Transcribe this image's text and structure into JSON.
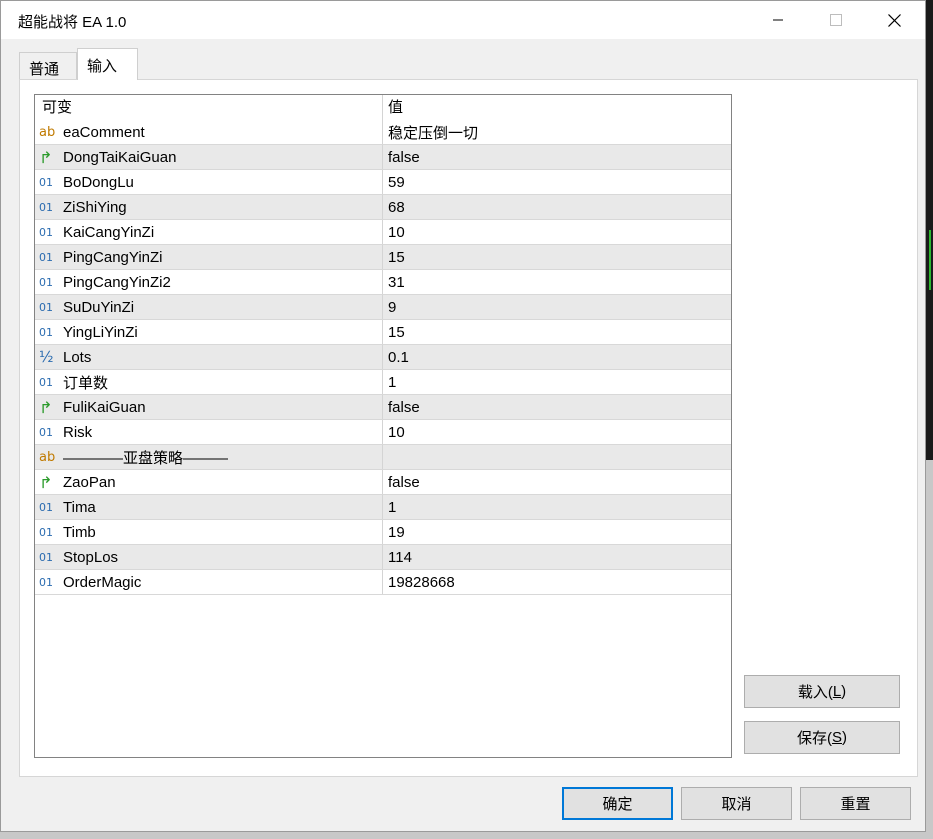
{
  "window": {
    "title": "超能战将 EA 1.0",
    "minimize_icon": "minimize-icon",
    "maximize_icon": "maximize-icon",
    "close_icon": "close-icon"
  },
  "tabs": [
    {
      "label": "普通",
      "active": false
    },
    {
      "label": "输入",
      "active": true
    }
  ],
  "grid": {
    "columns": [
      "可变",
      "值"
    ],
    "rows": [
      {
        "type": "string",
        "icon": "ab",
        "name": "eaComment",
        "value": "稳定压倒一切"
      },
      {
        "type": "bool",
        "icon": "↱",
        "name": "DongTaiKaiGuan",
        "value": "false"
      },
      {
        "type": "int",
        "icon": "01",
        "name": "BoDongLu",
        "value": "59"
      },
      {
        "type": "int",
        "icon": "01",
        "name": "ZiShiYing",
        "value": "68"
      },
      {
        "type": "int",
        "icon": "01",
        "name": "KaiCangYinZi",
        "value": "10"
      },
      {
        "type": "int",
        "icon": "01",
        "name": "PingCangYinZi",
        "value": "15"
      },
      {
        "type": "int",
        "icon": "01",
        "name": "PingCangYinZi2",
        "value": "31"
      },
      {
        "type": "int",
        "icon": "01",
        "name": "SuDuYinZi",
        "value": "9"
      },
      {
        "type": "int",
        "icon": "01",
        "name": "YingLiYinZi",
        "value": "15"
      },
      {
        "type": "double",
        "icon": "½",
        "name": "Lots",
        "value": "0.1"
      },
      {
        "type": "int",
        "icon": "01",
        "name": "订单数",
        "value": "1"
      },
      {
        "type": "bool",
        "icon": "↱",
        "name": "FuliKaiGuan",
        "value": "false"
      },
      {
        "type": "int",
        "icon": "01",
        "name": "Risk",
        "value": "10"
      },
      {
        "type": "string",
        "icon": "ab",
        "name": "————亚盘策略———",
        "value": ""
      },
      {
        "type": "bool",
        "icon": "↱",
        "name": "ZaoPan",
        "value": "false"
      },
      {
        "type": "int",
        "icon": "01",
        "name": "Tima",
        "value": "1"
      },
      {
        "type": "int",
        "icon": "01",
        "name": "Timb",
        "value": "19"
      },
      {
        "type": "int",
        "icon": "01",
        "name": "StopLos",
        "value": "114"
      },
      {
        "type": "int",
        "icon": "01",
        "name": "OrderMagic",
        "value": "19828668"
      }
    ]
  },
  "side_buttons": {
    "load": {
      "label": "载入(",
      "key": "L",
      "close": ")"
    },
    "save": {
      "label": "保存(",
      "key": "S",
      "close": ")"
    }
  },
  "footer_buttons": {
    "ok": "确定",
    "cancel": "取消",
    "reset": "重置"
  }
}
